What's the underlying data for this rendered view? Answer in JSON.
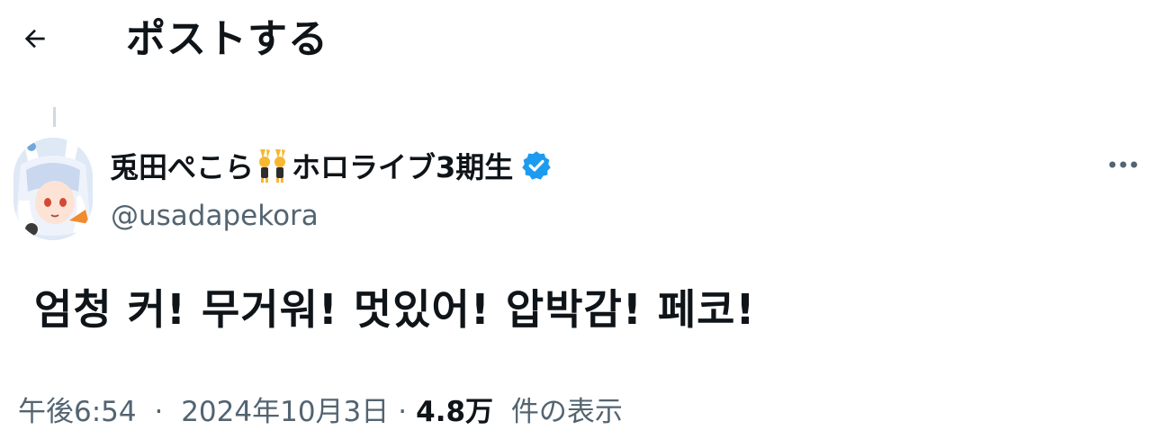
{
  "header": {
    "back_icon": "arrow-left-icon",
    "title": "ポストする"
  },
  "post": {
    "author": {
      "name_part1": "兎田ぺこら",
      "name_emoji": "bunny-pair-emoji",
      "name_part2": "ホロライブ3期生",
      "verified_icon": "verified-badge-icon",
      "verified_color": "#1d9bf0",
      "handle": "@usadapekora"
    },
    "more_icon": "more-horizontal-icon",
    "text": "엄청 커! 무거워! 멋있어! 압박감! 페코!",
    "meta": {
      "time": "午後6:54",
      "separator": "·",
      "date": "2024年10月3日",
      "views_count": "4.8万",
      "views_label": "件の表示"
    }
  }
}
